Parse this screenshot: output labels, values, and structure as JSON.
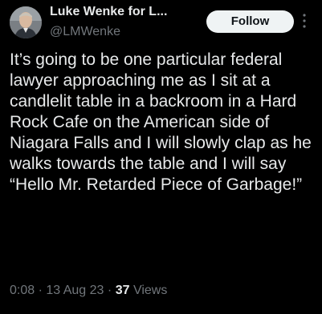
{
  "author": {
    "display_name": "Luke Wenke for L...",
    "handle": "@LMWenke"
  },
  "follow_label": "Follow",
  "more_icon": "more-vertical-icon",
  "tweet_text": "It’s going to be one particular federal lawyer approaching me as I sit at a candlelit table in a backroom in a Hard Rock Cafe on the American side of Niagara Falls and I will slowly clap as he walks towards the table and I will say “Hello Mr. Retarded Piece of Garbage!”",
  "meta": {
    "time": "0:08",
    "separator": "·",
    "date": "13 Aug 23",
    "views_count": "37",
    "views_label": "Views"
  },
  "colors": {
    "background": "#000000",
    "text": "#e7e9ea",
    "secondary": "#71767b",
    "button_bg": "#eff3f4",
    "button_text": "#0f1419"
  }
}
